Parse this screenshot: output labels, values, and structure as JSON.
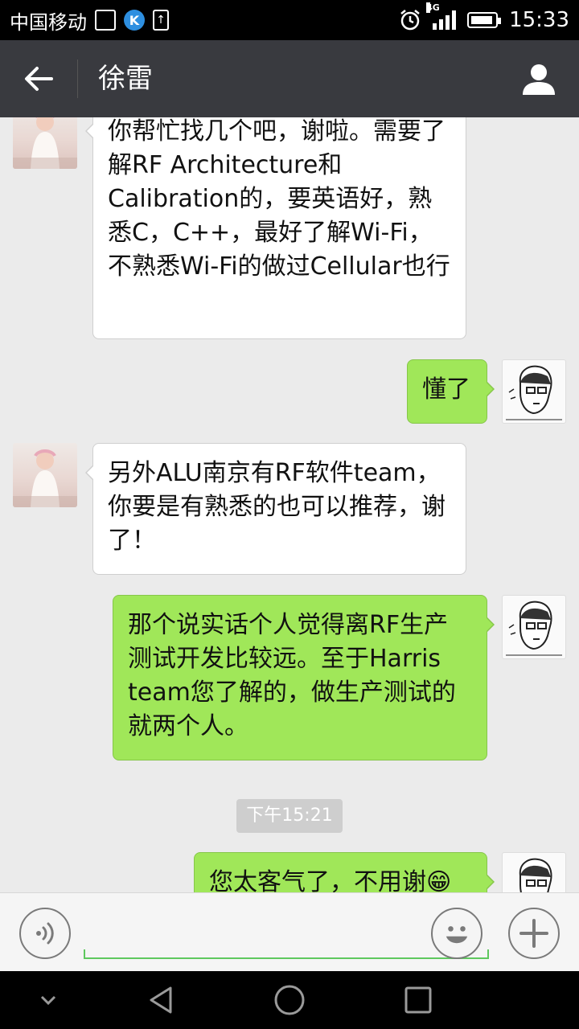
{
  "status_bar": {
    "carrier": "中国移动",
    "network": "4G",
    "time": "15:33"
  },
  "header": {
    "title": "徐雷"
  },
  "messages": [
    {
      "direction": "in",
      "text": "你帮忙找几个吧，谢啦。需要了解RF Architecture和Calibration的，要英语好，熟悉C，C++，最好了解Wi-Fi，不熟悉Wi-Fi的做过Cellular也行"
    },
    {
      "direction": "out",
      "text": "懂了"
    },
    {
      "direction": "in",
      "text": "另外ALU南京有RF软件team，你要是有熟悉的也可以推荐，谢了！"
    },
    {
      "direction": "out",
      "text": "那个说实话个人觉得离RF生产测试开发比较远。至于Harris team您了解的，做生产测试的就两个人。"
    },
    {
      "direction": "out",
      "text": "您太客气了，不用谢😁"
    }
  ],
  "timestamp": "下午15:21",
  "input": {
    "value": ""
  },
  "colors": {
    "header_bg": "#393a3f",
    "outgoing_bubble": "#a0e759",
    "incoming_bubble": "#ffffff",
    "chat_bg": "#ebebeb",
    "input_accent": "#5ec85e"
  },
  "icons": {
    "back": "back-arrow-icon",
    "profile": "person-icon",
    "voice": "voice-icon",
    "emoji": "emoji-icon",
    "plus": "plus-icon",
    "nav_down": "chevron-down-icon",
    "nav_back": "triangle-back-icon",
    "nav_home": "circle-home-icon",
    "nav_recent": "square-recent-icon"
  }
}
